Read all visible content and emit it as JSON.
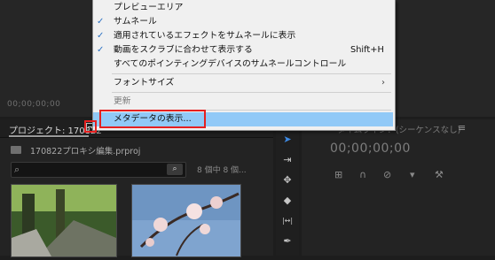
{
  "program_monitor": {
    "timecode": "00;00;00;00"
  },
  "project_panel": {
    "title": "プロジェクト: 170822",
    "filename": "170822プロキシ編集.prproj",
    "item_count": "8 個中 8 個...",
    "thumbnails": [
      {
        "icon": "thumb-video"
      },
      {
        "icon": "thumb-image"
      }
    ]
  },
  "tools": [
    {
      "icon": "selection-icon",
      "glyph": "➤"
    },
    {
      "icon": "track-select-icon",
      "glyph": "⇥"
    },
    {
      "icon": "ripple-edit-icon",
      "glyph": "✥"
    },
    {
      "icon": "razor-icon",
      "glyph": "◆"
    },
    {
      "icon": "slip-icon",
      "glyph": "|↔|"
    },
    {
      "icon": "pen-icon",
      "glyph": "✒"
    }
  ],
  "timeline": {
    "title": "タイムライン：(シーケンスなし)",
    "menu_icon": "≡",
    "timecode": "00;00;00;00"
  },
  "menu": {
    "items": [
      {
        "label": "プレビューエリア",
        "checked": false
      },
      {
        "label": "サムネール",
        "checked": true
      },
      {
        "label": "適用されているエフェクトをサムネールに表示",
        "checked": true
      },
      {
        "label": "動画をスクラブに合わせて表示する",
        "checked": true,
        "shortcut": "Shift+H"
      },
      {
        "label": "すべてのポインティングデバイスのサムネールコントロール",
        "checked": false
      },
      {
        "label": "フォントサイズ",
        "submenu": true
      },
      {
        "label": "更新",
        "disabled": true
      },
      {
        "label": "メタデータの表示...",
        "highlighted": true
      }
    ],
    "check_glyph": "✓",
    "submenu_glyph": "›"
  },
  "colors": {
    "accent": "#3d8ae4",
    "highlight": "#91c9f7",
    "annotation": "#e52020"
  }
}
